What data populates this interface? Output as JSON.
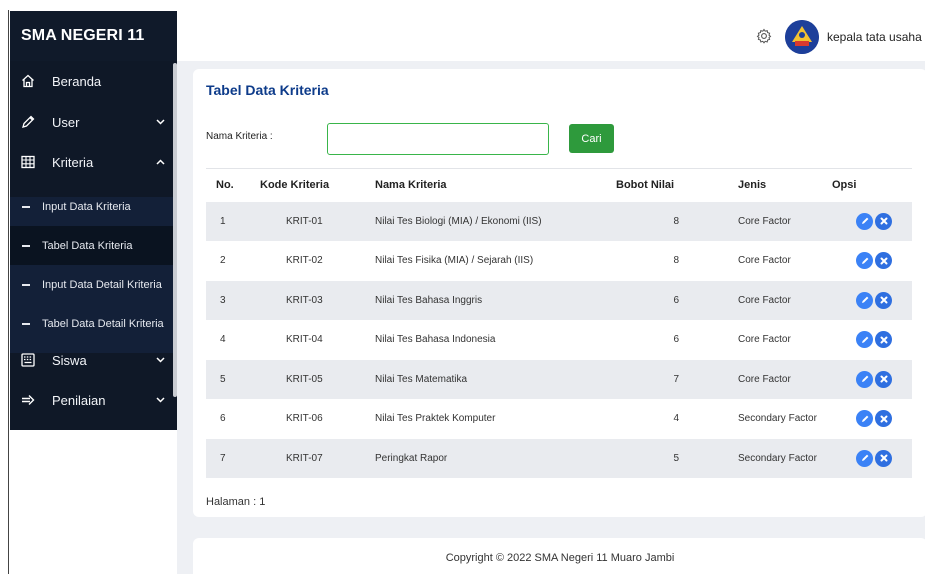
{
  "sidebar": {
    "brand": "SMA NEGERI 11",
    "menu": [
      {
        "label": "Beranda",
        "icon": "home-icon"
      },
      {
        "label": "User",
        "icon": "pen-icon"
      },
      {
        "label": "Kriteria",
        "icon": "grid-table-icon"
      },
      {
        "label": "Siswa",
        "icon": "keyboard-icon"
      },
      {
        "label": "Penilaian",
        "icon": "arrow-right-icon"
      }
    ],
    "submenu": [
      {
        "label": "Input Data Kriteria"
      },
      {
        "label": "Tabel Data Kriteria"
      },
      {
        "label": "Input Data Detail Kriteria"
      },
      {
        "label": "Tabel Data Detail Kriteria"
      }
    ]
  },
  "header": {
    "username": "kepala tata usaha"
  },
  "main": {
    "title": "Tabel Data Kriteria",
    "search": {
      "label": "Nama Kriteria :",
      "value": "",
      "button": "Cari"
    },
    "columns": [
      "No.",
      "Kode Kriteria",
      "Nama Kriteria",
      "Bobot Nilai",
      "Jenis",
      "Opsi"
    ],
    "rows": [
      {
        "no": "1",
        "kode": "KRIT-01",
        "nama": "Nilai Tes Biologi (MIA) / Ekonomi (IIS)",
        "bobot": "8",
        "jenis": "Core Factor"
      },
      {
        "no": "2",
        "kode": "KRIT-02",
        "nama": "Nilai Tes Fisika (MIA) / Sejarah (IIS)",
        "bobot": "8",
        "jenis": "Core Factor"
      },
      {
        "no": "3",
        "kode": "KRIT-03",
        "nama": "Nilai Tes Bahasa Inggris",
        "bobot": "6",
        "jenis": "Core Factor"
      },
      {
        "no": "4",
        "kode": "KRIT-04",
        "nama": "Nilai Tes Bahasa Indonesia",
        "bobot": "6",
        "jenis": "Core Factor"
      },
      {
        "no": "5",
        "kode": "KRIT-05",
        "nama": "Nilai Tes Matematika",
        "bobot": "7",
        "jenis": "Core Factor"
      },
      {
        "no": "6",
        "kode": "KRIT-06",
        "nama": "Nilai Tes Praktek Komputer",
        "bobot": "4",
        "jenis": "Secondary Factor"
      },
      {
        "no": "7",
        "kode": "KRIT-07",
        "nama": "Peringkat Rapor",
        "bobot": "5",
        "jenis": "Secondary Factor"
      }
    ],
    "pager": "Halaman : 1"
  },
  "footer": {
    "text": "Copyright © 2022 SMA Negeri 11 Muaro Jambi"
  },
  "colors": {
    "sidebar_bg": "#0f1827",
    "title": "#0d3b8a",
    "search_button": "#2e9a3c",
    "action_icon": "#3b82f6"
  }
}
